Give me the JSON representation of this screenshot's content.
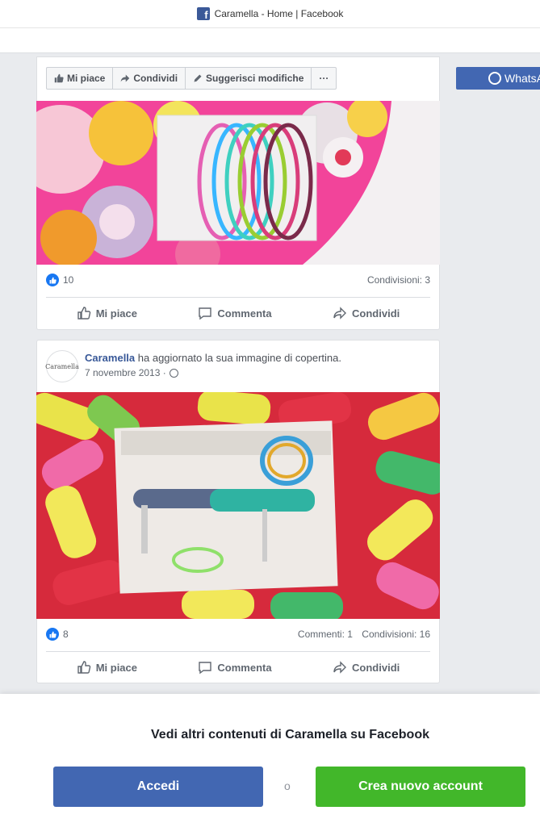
{
  "window": {
    "title": "Caramella - Home | Facebook"
  },
  "page_actions": {
    "like": "Mi piace",
    "share": "Condividi",
    "suggest": "Suggerisci modifiche",
    "more": "···",
    "whatsapp": "WhatsA"
  },
  "posts": [
    {
      "likes": "10",
      "shares": "Condivisioni: 3",
      "actions": {
        "like": "Mi piace",
        "comment": "Commenta",
        "share": "Condividi"
      }
    },
    {
      "author": "Caramella",
      "activity": " ha aggiornato la sua immagine di copertina.",
      "date": "7 novembre 2013 ·",
      "avatar_text": "Caramella",
      "likes": "8",
      "comments": "Commenti: 1",
      "shares": "Condivisioni: 16",
      "actions": {
        "like": "Mi piace",
        "comment": "Commenta",
        "share": "Condividi"
      }
    }
  ],
  "login_prompt": {
    "title": "Vedi altri contenuti di Caramella su Facebook",
    "login": "Accedi",
    "or": "o",
    "create": "Crea nuovo account"
  },
  "colors": {
    "brand": "#4267b2",
    "link": "#385898",
    "create": "#42b72a",
    "like_badge": "#1877f2"
  }
}
